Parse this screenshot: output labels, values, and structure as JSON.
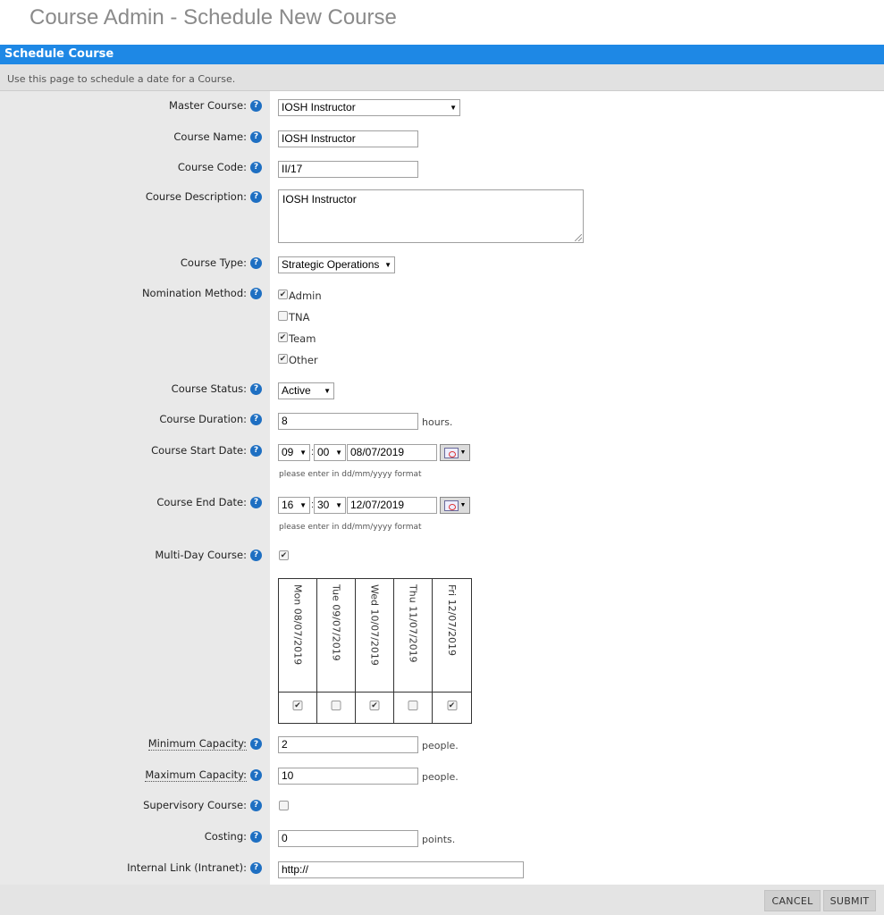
{
  "page": {
    "title": "Course Admin - Schedule New Course"
  },
  "panel": {
    "header": "Schedule Course",
    "description": "Use this page to schedule a date for a Course."
  },
  "help_glyph": "?",
  "fields": {
    "master_course": {
      "label": "Master Course:",
      "value": "IOSH Instructor"
    },
    "course_name": {
      "label": "Course Name:",
      "value": "IOSH Instructor"
    },
    "course_code": {
      "label": "Course Code:",
      "value": "II/17"
    },
    "course_description": {
      "label": "Course Description:",
      "value": "IOSH Instructor"
    },
    "course_type": {
      "label": "Course Type:",
      "value": "Strategic Operations"
    },
    "nomination_method": {
      "label": "Nomination Method:",
      "options": [
        {
          "label": "Admin",
          "checked": true,
          "mark": "✔"
        },
        {
          "label": "TNA",
          "checked": false,
          "mark": ""
        },
        {
          "label": "Team",
          "checked": true,
          "mark": "✔"
        },
        {
          "label": "Other",
          "checked": true,
          "mark": "✔"
        }
      ]
    },
    "course_status": {
      "label": "Course Status:",
      "value": "Active"
    },
    "course_duration": {
      "label": "Course Duration:",
      "value": "8",
      "suffix": "hours."
    },
    "start_date": {
      "label": "Course Start Date:",
      "hour": "09",
      "minute": "00",
      "date": "08/07/2019",
      "hint": "please enter in dd/mm/yyyy format"
    },
    "end_date": {
      "label": "Course End Date:",
      "hour": "16",
      "minute": "30",
      "date": "12/07/2019",
      "hint": "please enter in dd/mm/yyyy format"
    },
    "multi_day": {
      "label": "Multi-Day Course:",
      "checked": true,
      "mark": "✔"
    },
    "days": [
      {
        "label": "Mon 08/07/2019",
        "checked": true,
        "mark": "✔"
      },
      {
        "label": "Tue 09/07/2019",
        "checked": false,
        "mark": ""
      },
      {
        "label": "Wed 10/07/2019",
        "checked": true,
        "mark": "✔"
      },
      {
        "label": "Thu 11/07/2019",
        "checked": false,
        "mark": ""
      },
      {
        "label": "Fri 12/07/2019",
        "checked": true,
        "mark": "✔"
      }
    ],
    "min_capacity": {
      "label": "Minimum Capacity:",
      "value": "2",
      "suffix": "people."
    },
    "max_capacity": {
      "label": "Maximum Capacity:",
      "value": "10",
      "suffix": "people."
    },
    "supervisory": {
      "label": "Supervisory Course:",
      "checked": false,
      "mark": ""
    },
    "costing": {
      "label": "Costing:",
      "value": "0",
      "suffix": "points."
    },
    "internal_link": {
      "label": "Internal Link (Intranet):",
      "value": "http://"
    }
  },
  "buttons": {
    "cancel": "CANCEL",
    "submit": "SUBMIT"
  },
  "colors": {
    "header_bg": "#1e88e5",
    "label_bg": "#e9e9e9",
    "help_icon": "#1e6fc2"
  }
}
